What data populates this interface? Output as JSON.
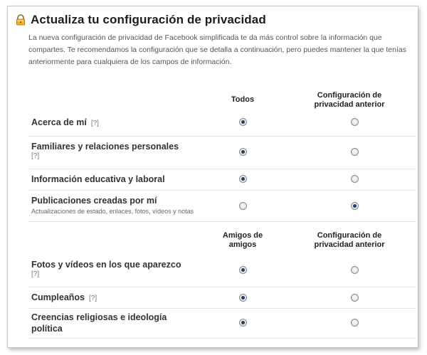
{
  "title": "Actualiza tu configuración de privacidad",
  "description": "La nueva configuración de privacidad de Facebook simplificada te da más control sobre la información que compartes. Te recomendamos la configuración que se detalla a continuación, pero puedes mantener la que tenías anteriormente para cualquiera de los campos de información.",
  "sections": [
    {
      "col1": "Todos",
      "col2": "Configuración de privacidad anterior",
      "rows": [
        {
          "label": "Acerca de mí",
          "help": "[?]",
          "sub": "",
          "selected": "col1"
        },
        {
          "label": "Familiares y relaciones personales",
          "help": "[?]",
          "sub": "",
          "selected": "col1"
        },
        {
          "label": "Información educativa y laboral",
          "help": "",
          "sub": "",
          "selected": "col1"
        },
        {
          "label": "Publicaciones creadas por mí",
          "help": "",
          "sub": "Actualizaciones de estado, enlaces, fotos, vídeos y notas",
          "selected": "col2"
        }
      ]
    },
    {
      "col1": "Amigos de amigos",
      "col2": "Configuración de privacidad anterior",
      "rows": [
        {
          "label": "Fotos y vídeos en los que aparezco",
          "help": "[?]",
          "sub": "",
          "selected": "col1"
        },
        {
          "label": "Cumpleaños",
          "help": "[?]",
          "sub": "",
          "selected": "col1"
        },
        {
          "label": "Creencias religiosas e ideología política",
          "help": "",
          "sub": "",
          "selected": "col1"
        }
      ]
    }
  ],
  "colors": {
    "radio_dot": "#1d3f6e",
    "lock": "#e3a21a"
  }
}
